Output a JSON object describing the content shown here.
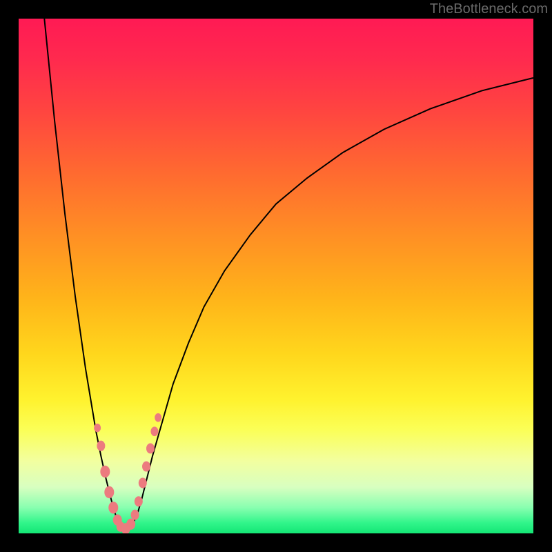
{
  "watermark": "TheBottleneck.com",
  "chart_data": {
    "type": "line",
    "title": "",
    "xlabel": "",
    "ylabel": "",
    "xlim": [
      0,
      100
    ],
    "ylim": [
      0,
      100
    ],
    "grid": false,
    "series": [
      {
        "name": "left-curve",
        "x": [
          5,
          6,
          7,
          8,
          9,
          10,
          11,
          12,
          13,
          14,
          15,
          16,
          17,
          18,
          19,
          19.5
        ],
        "y": [
          100,
          90,
          80,
          71,
          62,
          54,
          46,
          39,
          32,
          26,
          20,
          15,
          10.5,
          6.5,
          3,
          1.5
        ]
      },
      {
        "name": "right-curve",
        "x": [
          22,
          23,
          24,
          25,
          26,
          28,
          30,
          33,
          36,
          40,
          45,
          50,
          56,
          63,
          71,
          80,
          90,
          100
        ],
        "y": [
          1.5,
          3.5,
          7,
          11,
          15,
          22,
          29,
          37,
          44,
          51,
          58,
          64,
          69,
          74,
          78.5,
          82.5,
          86,
          88.5
        ]
      },
      {
        "name": "valley-floor",
        "x": [
          19.5,
          20,
          20.7,
          21.3,
          22
        ],
        "y": [
          1.5,
          0.8,
          0.5,
          0.8,
          1.5
        ]
      }
    ],
    "markers": {
      "color": "#ec7b7f",
      "points": [
        {
          "x": 15.3,
          "y": 20.5,
          "r": 5
        },
        {
          "x": 16.0,
          "y": 17.0,
          "r": 6
        },
        {
          "x": 16.8,
          "y": 12.0,
          "r": 7
        },
        {
          "x": 17.6,
          "y": 8.0,
          "r": 7
        },
        {
          "x": 18.4,
          "y": 5.0,
          "r": 7
        },
        {
          "x": 19.2,
          "y": 2.6,
          "r": 6.5
        },
        {
          "x": 19.8,
          "y": 1.3,
          "r": 6
        },
        {
          "x": 20.8,
          "y": 0.9,
          "r": 6.5
        },
        {
          "x": 21.8,
          "y": 1.8,
          "r": 6.5
        },
        {
          "x": 22.6,
          "y": 3.6,
          "r": 6
        },
        {
          "x": 23.3,
          "y": 6.2,
          "r": 6
        },
        {
          "x": 24.1,
          "y": 9.8,
          "r": 6
        },
        {
          "x": 24.8,
          "y": 13.0,
          "r": 6
        },
        {
          "x": 25.6,
          "y": 16.5,
          "r": 6
        },
        {
          "x": 26.4,
          "y": 19.8,
          "r": 5.5
        },
        {
          "x": 27.1,
          "y": 22.5,
          "r": 5
        }
      ]
    },
    "colors": {
      "curve": "#000000",
      "marker_fill": "#ec7b7f",
      "frame": "#000000"
    }
  }
}
